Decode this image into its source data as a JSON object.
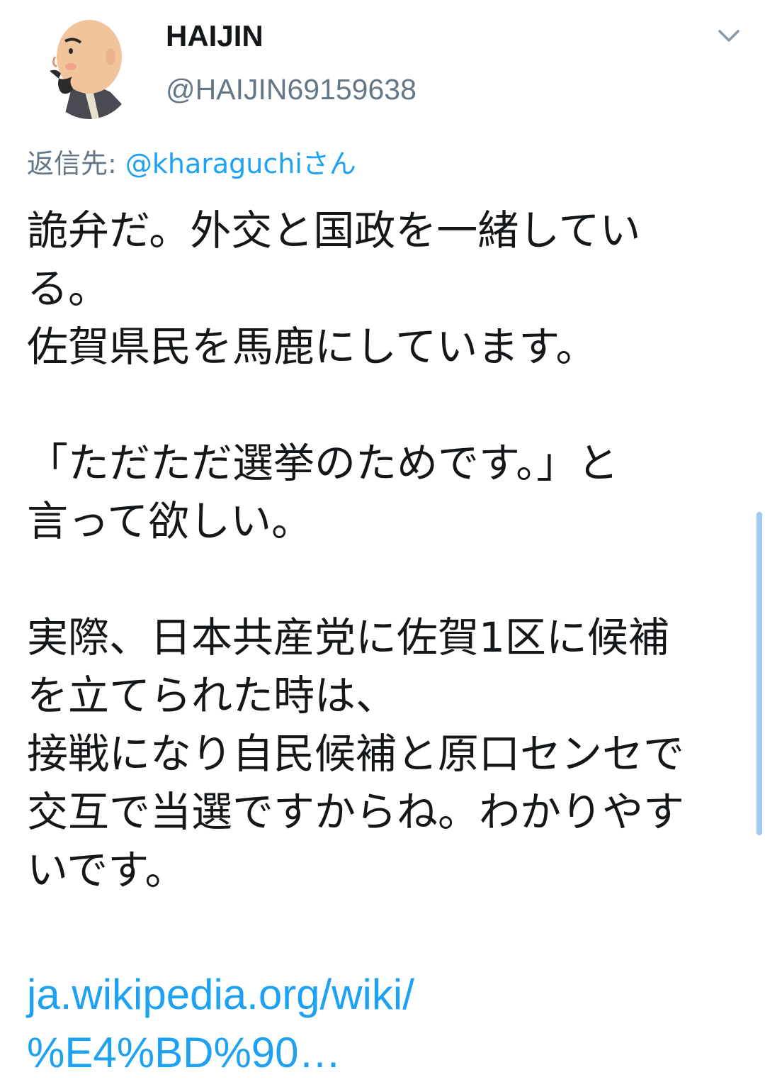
{
  "author": {
    "display_name": "HAIJIN",
    "handle": "@HAIJIN69159638",
    "avatar_icon": "monk-avatar-icon"
  },
  "reply_to": {
    "prefix": "返信先: ",
    "mention": "@kharaguchi",
    "suffix": "さん"
  },
  "tweet": {
    "lines": [
      "詭弁だ。外交と国政を一緒してい",
      "る。",
      "佐賀県民を馬鹿にしています。",
      "",
      "「ただただ選挙のためです。」と",
      "言って欲しい。",
      "",
      "実際、日本共産党に佐賀1区に候補",
      "を立てられた時は、",
      "接戦になり自民候補と原口センセで",
      "交互で当選ですからね。わかりやす",
      "いです。",
      ""
    ],
    "link_line1": "ja.wikipedia.org/wiki/",
    "link_line2": "%E4%BD%90…"
  },
  "colors": {
    "text": "#14171a",
    "secondary": "#657786",
    "accent": "#1da1f2"
  },
  "caret_icon": "chevron-down-icon"
}
